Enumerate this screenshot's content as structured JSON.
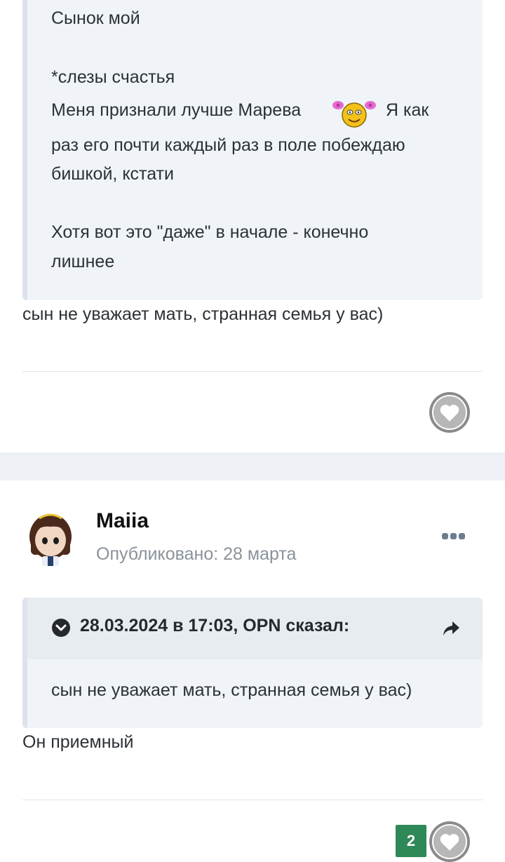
{
  "post1": {
    "quote_lines": [
      "Сынок мой",
      "*слезы счастья",
      "Меня признали лучше Марева",
      "Я как",
      "раз его почти каждый раз в поле побеждаю",
      "бишкой, кстати",
      "Хотя вот это \"даже\" в начале - конечно",
      "лишнее"
    ],
    "reply_text": "сын не уважает мать, странная семья у вас)"
  },
  "post2": {
    "author": "Maiia",
    "published": "Опубликовано: 28 марта",
    "quote_header": "28.03.2024 в 17:03, OPN сказал:",
    "quote_text": "сын не уважает мать, странная семья у вас)",
    "reply_text": "Он приемный",
    "reaction_count": "2"
  },
  "colors": {
    "reaction_badge": "#2e8857",
    "quote_background": "#f0f4f8",
    "section_gap": "#edf1f5"
  }
}
